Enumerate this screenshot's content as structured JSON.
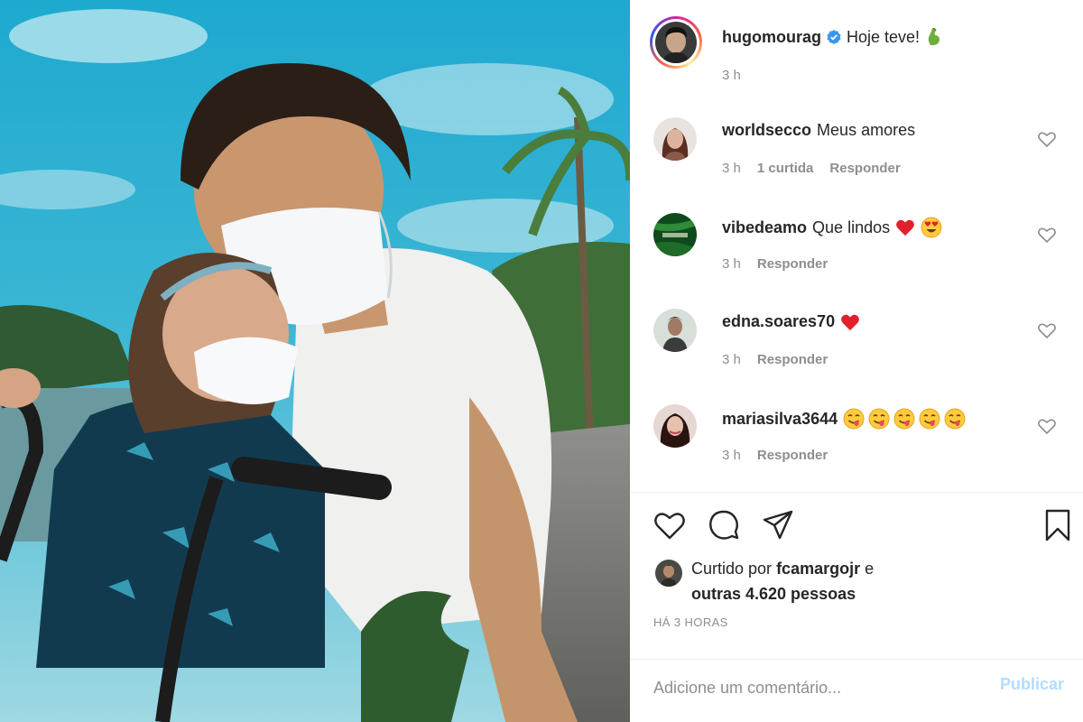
{
  "post": {
    "author": {
      "username": "hugomourag",
      "verified": true,
      "verified_icon": "verified-badge-icon",
      "caption_text": "Hoje teve!",
      "caption_emoji": "flexed-biceps-emoji",
      "time": "3 h"
    },
    "photo_description_icon": "photo"
  },
  "comments": [
    {
      "username": "worldsecco",
      "text": "Meus amores",
      "emojis": [],
      "time": "3 h",
      "likes": "1 curtida",
      "reply": "Responder"
    },
    {
      "username": "vibedeamo",
      "text": "Que lindos",
      "emojis": [
        "red-heart-emoji",
        "heart-eyes-emoji"
      ],
      "time": "3 h",
      "likes": "",
      "reply": "Responder"
    },
    {
      "username": "edna.soares70",
      "text": "",
      "emojis": [
        "red-heart-emoji"
      ],
      "time": "3 h",
      "likes": "",
      "reply": "Responder"
    },
    {
      "username": "mariasilva3644",
      "text": "",
      "emojis": [
        "face-savoring-food-emoji",
        "face-savoring-food-emoji",
        "face-savoring-food-emoji",
        "face-savoring-food-emoji",
        "face-savoring-food-emoji"
      ],
      "time": "3 h",
      "likes": "",
      "reply": "Responder"
    }
  ],
  "actions": {
    "like_icon": "heart-outline-icon",
    "comment_icon": "comment-bubble-icon",
    "share_icon": "paper-plane-icon",
    "save_icon": "bookmark-icon"
  },
  "likes": {
    "prefix": "Curtido por",
    "user": "fcamargojr",
    "connector": "e",
    "others": "outras 4.620 pessoas"
  },
  "posted_ago": "HÁ 3 HORAS",
  "add_comment": {
    "placeholder": "Adicione um comentário...",
    "publish_label": "Publicar"
  },
  "colors": {
    "text": "#262626",
    "secondary": "#8e8e8e",
    "verified": "#3897f0",
    "publish_disabled": "#b3dbff",
    "heart": "#ed4956"
  }
}
